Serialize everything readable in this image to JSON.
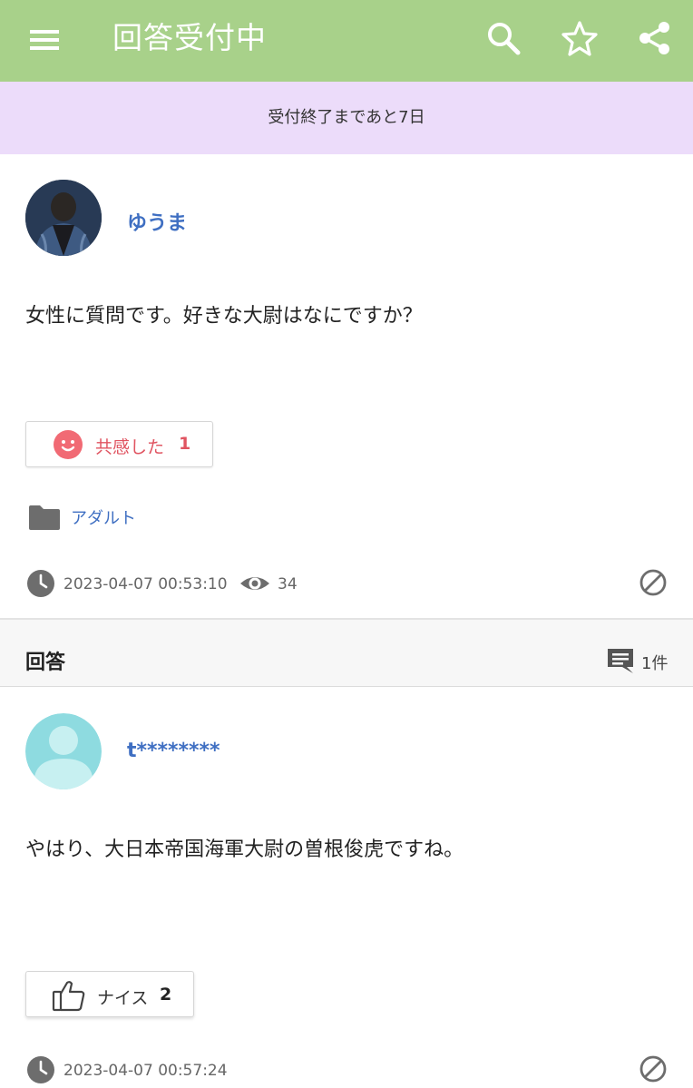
{
  "appbar": {
    "title": "回答受付中",
    "menu_icon": "menu-icon",
    "search_icon": "search-icon",
    "star_icon": "star-outline-icon",
    "share_icon": "share-icon",
    "bg_color": "#a8d18a"
  },
  "notice": {
    "text": "受付終了まであと7日",
    "bg_color": "#ecdcfa"
  },
  "question": {
    "author": "ゆうま",
    "text": "女性に質問です。好きな大尉はなにですか？",
    "empathy": {
      "label": "共感した",
      "count": "1",
      "icon": "smiley-face-icon"
    },
    "category": {
      "icon": "folder-icon",
      "label": "アダルト"
    },
    "timestamp": "2023-04-07 00:53:10",
    "views": "34",
    "report_icon": "block-icon"
  },
  "answers": {
    "heading": "回答",
    "count_label": "1件",
    "count_icon": "comment-icon",
    "items": [
      {
        "author": "t********",
        "text": "やはり、大日本帝国海軍大尉の曽根俊虎ですね。",
        "nice": {
          "label": "ナイス",
          "count": "2",
          "icon": "thumbs-up-icon"
        },
        "timestamp": "2023-04-07 00:57:24",
        "report_icon": "block-icon"
      }
    ]
  },
  "colors": {
    "link": "#3f6fc2",
    "empathy": "#e05461"
  }
}
